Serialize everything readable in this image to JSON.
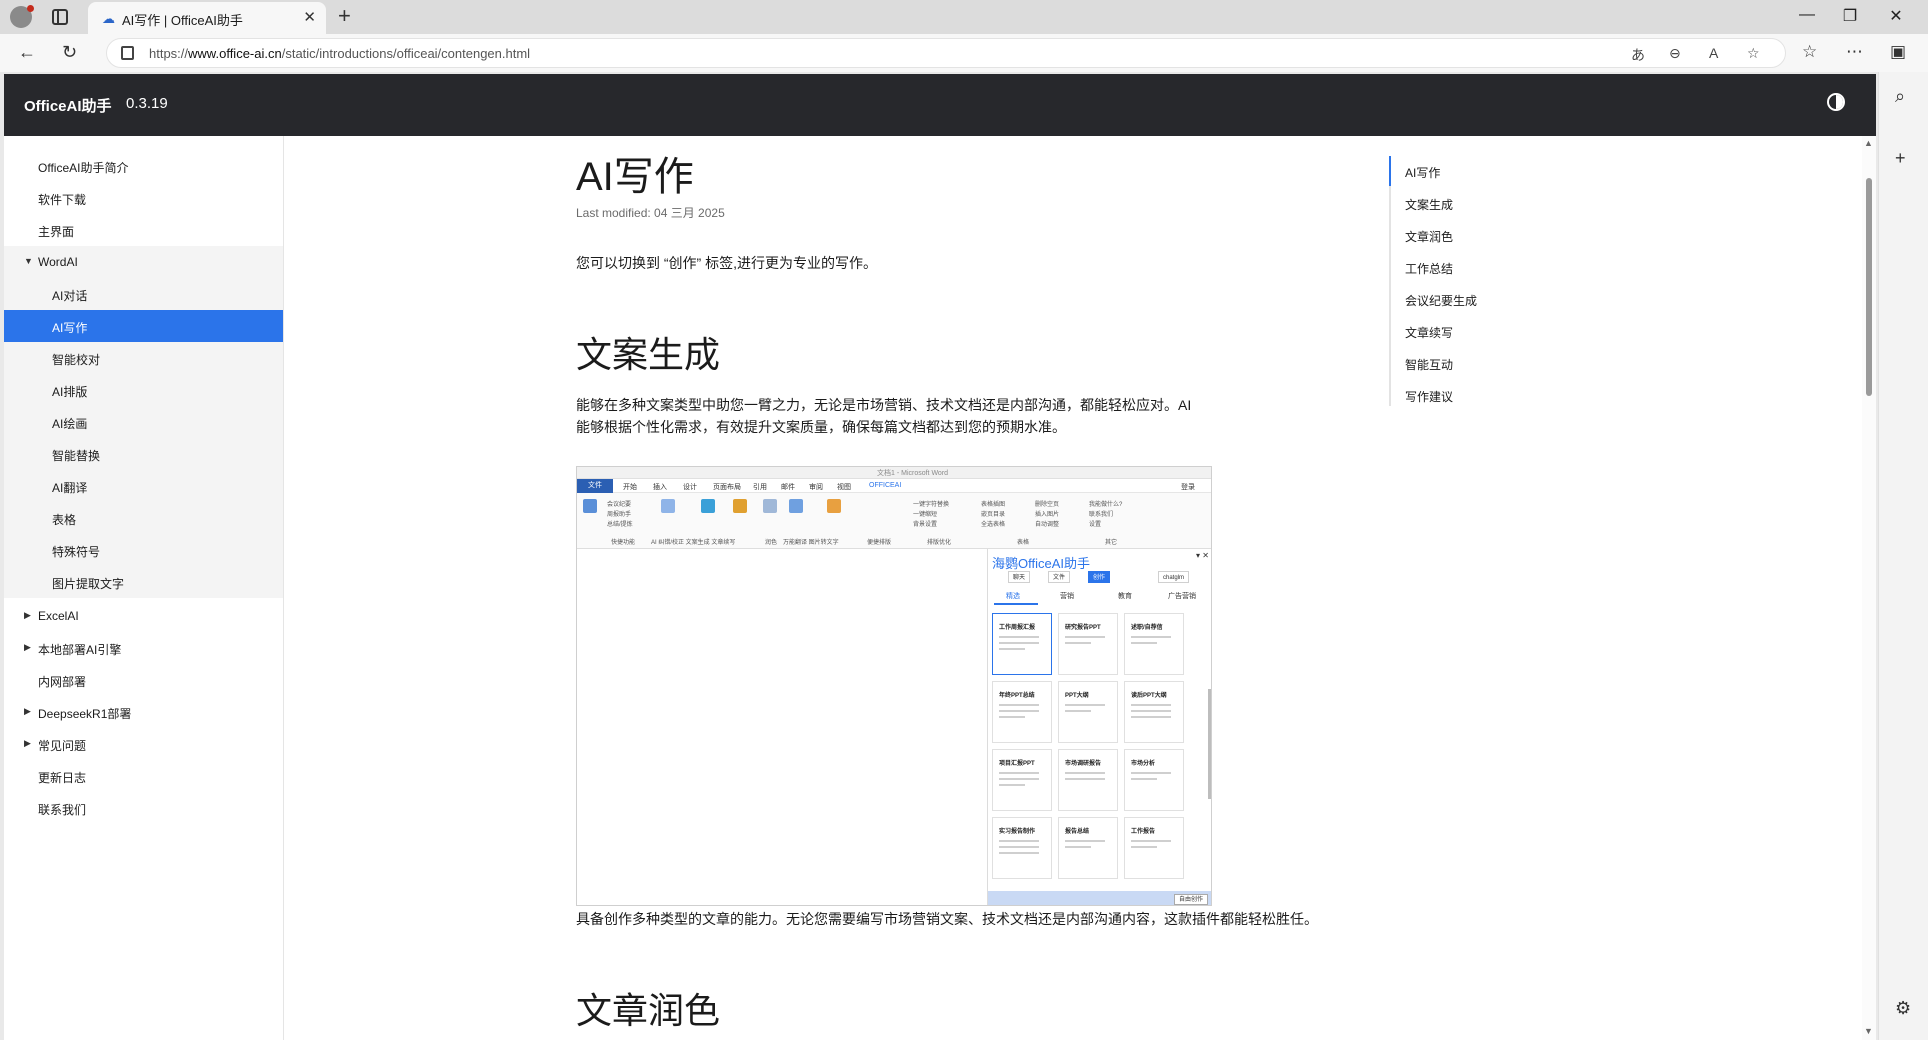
{
  "browser": {
    "tab_title": "AI写作 | OfficeAI助手",
    "url_prefix": "https://",
    "url_host": "www.office-ai.cn",
    "url_path": "/static/introductions/officeai/contengen.html"
  },
  "header": {
    "brand": "OfficeAI助手",
    "version": "0.3.19"
  },
  "sidebar": {
    "items": [
      {
        "label": "OfficeAI助手简介"
      },
      {
        "label": "软件下载"
      },
      {
        "label": "主界面"
      },
      {
        "label": "WordAI"
      },
      {
        "label": "AI对话"
      },
      {
        "label": "AI写作"
      },
      {
        "label": "智能校对"
      },
      {
        "label": "AI排版"
      },
      {
        "label": "AI绘画"
      },
      {
        "label": "智能替换"
      },
      {
        "label": "AI翻译"
      },
      {
        "label": "表格"
      },
      {
        "label": "特殊符号"
      },
      {
        "label": "图片提取文字"
      },
      {
        "label": "ExcelAI"
      },
      {
        "label": "本地部署AI引擎"
      },
      {
        "label": "内网部署"
      },
      {
        "label": "DeepseekR1部署"
      },
      {
        "label": "常见问题"
      },
      {
        "label": "更新日志"
      },
      {
        "label": "联系我们"
      }
    ]
  },
  "content": {
    "title": "AI写作",
    "last_modified": "Last modified: 04 三月 2025",
    "intro": "您可以切换到 “创作” 标签,进行更为专业的写作。",
    "section1_title": "文案生成",
    "section1_p1": "能够在多种文案类型中助您一臂之力，无论是市场营销、技术文档还是内部沟通，都能轻松应对。AI",
    "section1_p2": "能够根据个性化需求，有效提升文案质量，确保每篇文档都达到您的预期水准。",
    "caption": "具备创作多种类型的文章的能力。无论您需要编写市场营销文案、技术文档还是内部沟通内容，这款插件都能轻松胜任。",
    "section2_title": "文章润色"
  },
  "screenshot": {
    "window_title": "文档1 - Microsoft Word",
    "file_tab": "文件",
    "ribbon_tabs": [
      "开始",
      "插入",
      "设计",
      "页面布局",
      "引用",
      "邮件",
      "审阅",
      "视图",
      "OFFICEAI",
      "登录"
    ],
    "pane_title": "海鹦OfficeAI助手",
    "modes": [
      "聊天",
      "文件",
      "创作"
    ],
    "model": "chatglm",
    "pane_tabs": [
      "精选",
      "营销",
      "教育",
      "广告营销"
    ],
    "cards": [
      "工作周报汇报",
      "研究报告PPT",
      "述职/自荐信",
      "年终PPT总结",
      "PPT大纲",
      "读后PPT大纲",
      "项目汇报PPT",
      "市场调研报告",
      "市场分析",
      "实习报告制作",
      "报告总结",
      "工作报告"
    ],
    "footer_button": "自由创作"
  },
  "toc": {
    "items": [
      "AI写作",
      "文案生成",
      "文章润色",
      "工作总结",
      "会议纪要生成",
      "文章续写",
      "智能互动",
      "写作建议"
    ]
  },
  "colors": {
    "accent": "#2b74ea",
    "header_bg": "#27282c"
  }
}
